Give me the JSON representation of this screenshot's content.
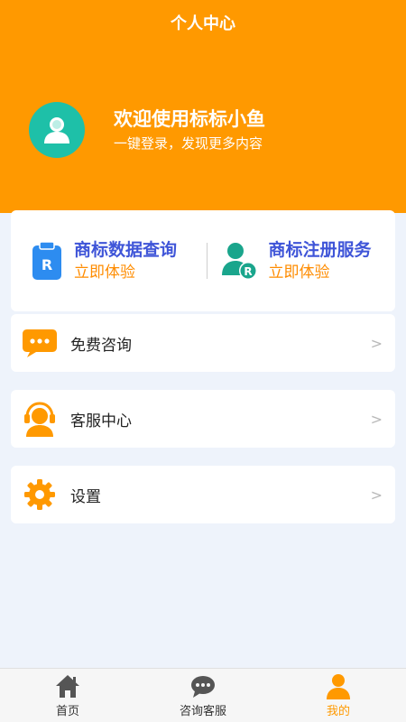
{
  "header": {
    "title": "个人中心",
    "welcome": "欢迎使用标标小鱼",
    "subline": "一键登录，发现更多内容"
  },
  "services": [
    {
      "title": "商标数据查询",
      "link": "立即体验",
      "icon": "trademark-query-icon"
    },
    {
      "title": "商标注册服务",
      "link": "立即体验",
      "icon": "trademark-register-icon"
    }
  ],
  "menu": [
    {
      "label": "免费咨询",
      "icon": "chat-bubble-icon",
      "arrow": ">"
    },
    {
      "label": "客服中心",
      "icon": "headset-icon",
      "arrow": ">"
    },
    {
      "label": "设置",
      "icon": "gear-icon",
      "arrow": ">"
    }
  ],
  "tabs": [
    {
      "label": "首页",
      "icon": "home-icon",
      "active": false
    },
    {
      "label": "咨询客服",
      "icon": "chat-icon",
      "active": false
    },
    {
      "label": "我的",
      "icon": "user-icon",
      "active": true
    }
  ],
  "colors": {
    "accent": "#ff9900",
    "service_title": "#3f55d8",
    "service_link": "#ff8c00",
    "avatar_bg": "#1ec0a8"
  }
}
